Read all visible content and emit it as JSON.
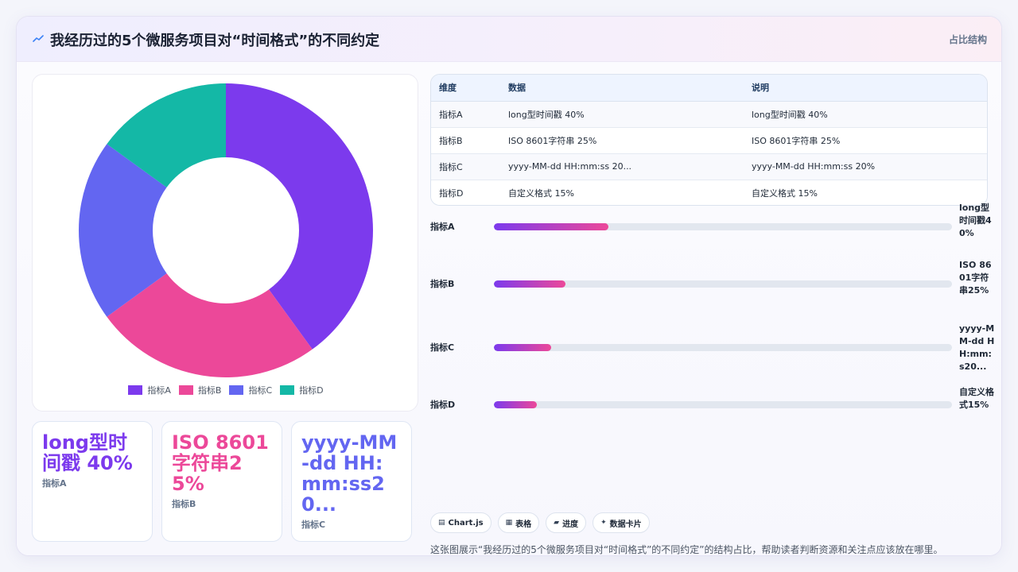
{
  "header": {
    "title": "我经历过的5个微服务项目对“时间格式”的不同约定",
    "right_label": "占比结构",
    "icon": "sparkline-icon"
  },
  "colors": {
    "indicator_a": "#7c3aed",
    "indicator_b": "#ec4899",
    "indicator_c": "#6366f1",
    "indicator_d": "#14b8a6",
    "bar_gradient_start": "#7c3aed",
    "bar_gradient_end": "#ec4899"
  },
  "chart_data": {
    "type": "pie",
    "variant": "doughnut",
    "categories": [
      "指标A",
      "指标B",
      "指标C",
      "指标D"
    ],
    "values": [
      40,
      25,
      20,
      15
    ],
    "colors": [
      "#7c3aed",
      "#ec4899",
      "#6366f1",
      "#14b8a6"
    ],
    "legend_position": "bottom"
  },
  "table": {
    "headers": [
      "维度",
      "数据",
      "说明"
    ],
    "rows": [
      [
        "指标A",
        "long型时间戳 40%",
        "long型时间戳 40%"
      ],
      [
        "指标B",
        "ISO 8601字符串 25%",
        "ISO 8601字符串 25%"
      ],
      [
        "指标C",
        "yyyy-MM-dd HH:mm:ss 20...",
        "yyyy-MM-dd HH:mm:ss 20%"
      ],
      [
        "指标D",
        "自定义格式 15%",
        "自定义格式 15%"
      ]
    ]
  },
  "progress": [
    {
      "label": "指标A",
      "value_text": "long型时间戳40%",
      "fraction": 0.25
    },
    {
      "label": "指标B",
      "value_text": "ISO 8601字符串25%",
      "fraction": 0.156
    },
    {
      "label": "指标C",
      "value_text": "yyyy-MM-dd HH:mm:s20...",
      "fraction": 0.125
    },
    {
      "label": "指标D",
      "value_text": "自定义格式15%",
      "fraction": 0.094
    }
  ],
  "stat_cards": [
    {
      "value": "long型时间戳 40%",
      "label": "指标A",
      "color": "#7c3aed"
    },
    {
      "value": "ISO 8601字符串25%",
      "label": "指标B",
      "color": "#ec4899"
    },
    {
      "value": "yyyy-MM-dd HH:mm:ss20...",
      "label": "指标C",
      "color": "#6366f1"
    }
  ],
  "chips": [
    {
      "icon": "▤",
      "label": "Chart.js"
    },
    {
      "icon": "▦",
      "label": "表格"
    },
    {
      "icon": "▰",
      "label": "进度"
    },
    {
      "icon": "✦",
      "label": "数据卡片"
    }
  ],
  "caption": "这张图展示“我经历过的5个微服务项目对“时间格式”的不同约定”的结构占比，帮助读者判断资源和关注点应该放在哪里。"
}
